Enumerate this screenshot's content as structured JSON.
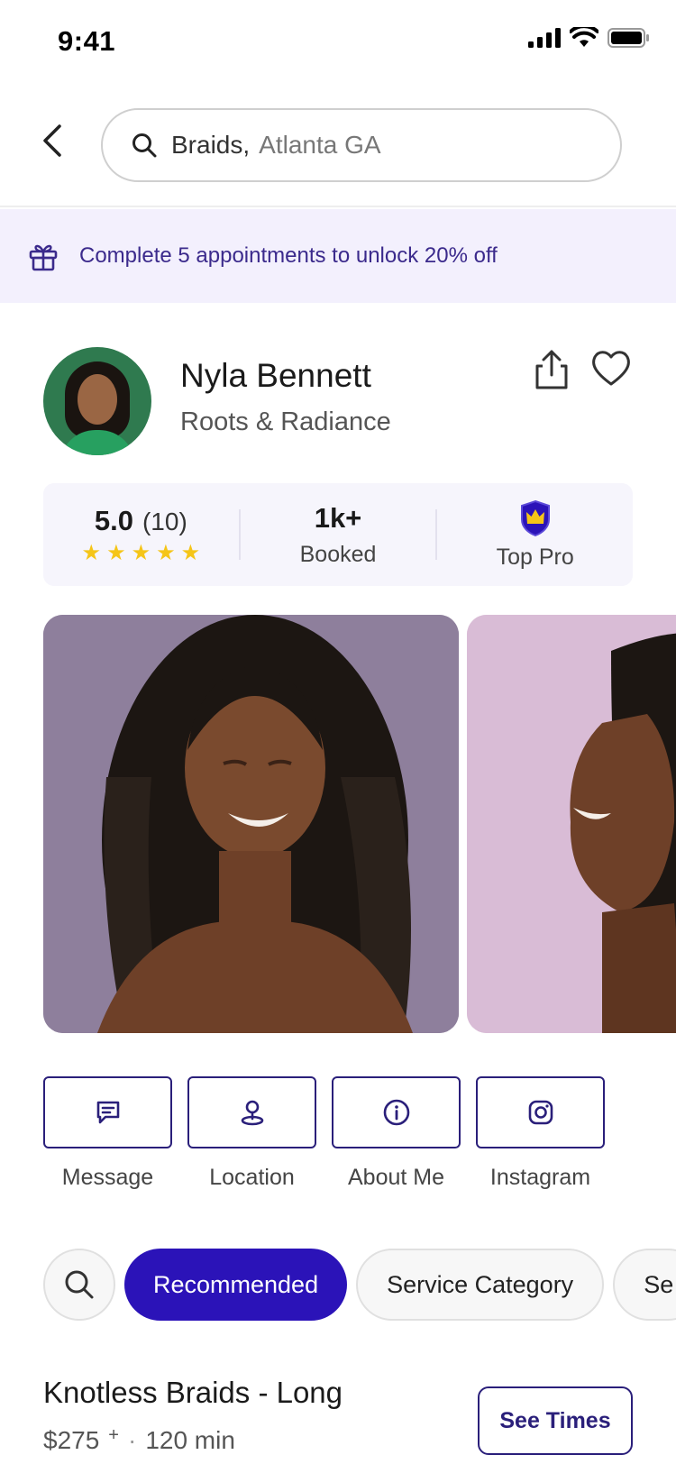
{
  "status_bar": {
    "time": "9:41"
  },
  "search": {
    "query": "Braids,",
    "location": "Atlanta GA"
  },
  "promo": {
    "text": "Complete 5 appointments to unlock 20% off"
  },
  "profile": {
    "name": "Nyla Bennett",
    "salon": "Roots & Radiance"
  },
  "stats": {
    "rating": "5.0",
    "rating_count": "(10)",
    "stars": 5,
    "booked_value": "1k+",
    "booked_label": "Booked",
    "badge_label": "Top Pro"
  },
  "actions": [
    {
      "label": "Message",
      "icon": "message-icon"
    },
    {
      "label": "Location",
      "icon": "location-pin-icon"
    },
    {
      "label": "About Me",
      "icon": "info-icon"
    },
    {
      "label": "Instagram",
      "icon": "instagram-icon"
    }
  ],
  "filters": {
    "chips": [
      {
        "label": "Recommended",
        "active": true
      },
      {
        "label": "Service Category",
        "active": false
      },
      {
        "label": "Se",
        "active": false
      }
    ]
  },
  "service": {
    "name": "Knotless Braids - Long",
    "price": "$275",
    "price_suffix": "+",
    "separator": "·",
    "duration": "120 min",
    "cta": "See Times"
  },
  "colors": {
    "brand": "#2b13b8",
    "accent_dark": "#2a1f7a",
    "promo_bg": "#f3f0fd",
    "star": "#f5c518"
  }
}
